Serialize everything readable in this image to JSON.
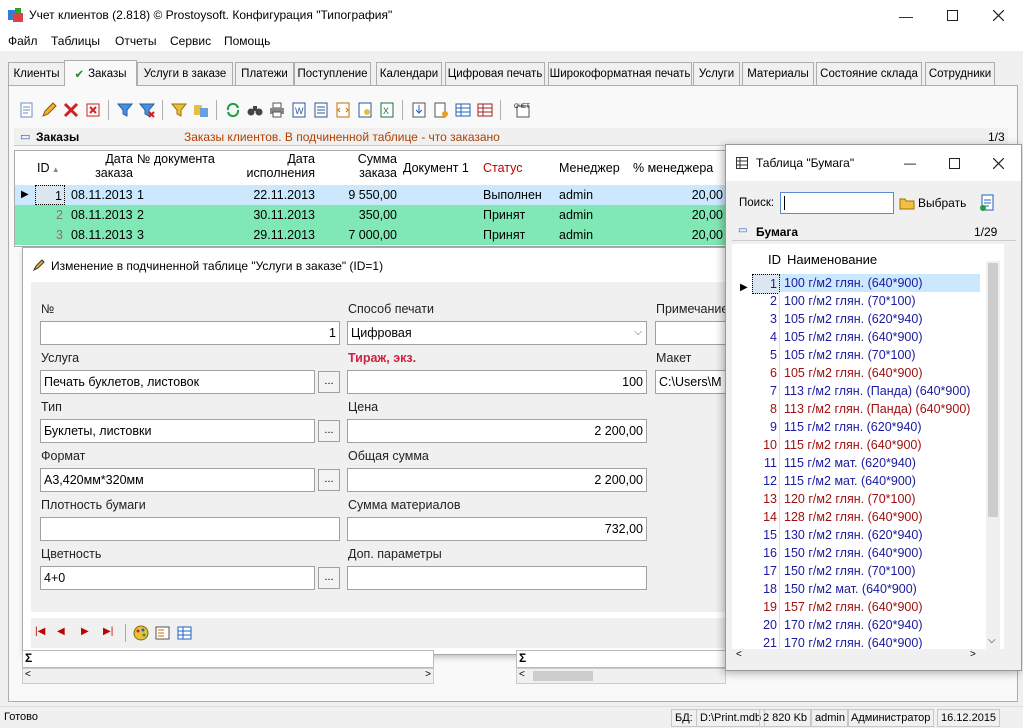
{
  "window": {
    "title": "Учет клиентов (2.818) © Prostoysoft. Конфигурация \"Типография\""
  },
  "menu": [
    "Файл",
    "Таблицы",
    "Отчеты",
    "Сервис",
    "Помощь"
  ],
  "tabs": [
    "Клиенты",
    "Заказы",
    "Услуги в заказе",
    "Платежи",
    "Поступление",
    "Календари",
    "Цифровая печать",
    "Широкоформатная печать",
    "Услуги",
    "Материалы",
    "Состояние склада",
    "Сотрудники"
  ],
  "orders": {
    "header_title": "Заказы",
    "header_desc": "Заказы клиентов. В подчиненной таблице - что заказано",
    "counter": "1/3",
    "columns": [
      "ID",
      "Дата заказа",
      "№ документа",
      "Дата исполнения",
      "Сумма заказа",
      "Документ 1",
      "Статус",
      "Менеджер",
      "% менеджера"
    ],
    "rows": [
      {
        "id": "1",
        "date": "08.11.2013",
        "num": "1",
        "exec": "22.11.2013",
        "sum": "9 550,00",
        "doc": "",
        "status": "Выполнен",
        "manager": "admin",
        "pct": "20,00"
      },
      {
        "id": "2",
        "date": "08.11.2013",
        "num": "2",
        "exec": "30.11.2013",
        "sum": "350,00",
        "doc": "",
        "status": "Принят",
        "manager": "admin",
        "pct": "20,00"
      },
      {
        "id": "3",
        "date": "08.11.2013",
        "num": "3",
        "exec": "29.11.2013",
        "sum": "7 000,00",
        "doc": "",
        "status": "Принят",
        "manager": "admin",
        "pct": "20,00"
      }
    ]
  },
  "editor": {
    "title": "Изменение в подчиненной таблице \"Услуги в заказе\" (ID=1)",
    "num_label": "№",
    "num_value": "1",
    "print_label": "Способ печати",
    "print_value": "Цифровая",
    "note_label": "Примечание",
    "service_label": "Услуга",
    "service_value": "Печать буклетов, листовок",
    "tirage_label": "Тираж, экз.",
    "tirage_value": "100",
    "maket_label": "Макет",
    "maket_value": "C:\\Users\\M",
    "type_label": "Тип",
    "type_value": "Буклеты, листовки",
    "price_label": "Цена",
    "price_value": "2 200,00",
    "format_label": "Формат",
    "format_value": "А3,420мм*320мм",
    "total_label": "Общая сумма",
    "total_value": "2 200,00",
    "density_label": "Плотность бумаги",
    "density_value": "",
    "materials_label": "Сумма материалов",
    "materials_value": "732,00",
    "color_label": "Цветность",
    "color_value": "4+0",
    "extra_label": "Доп. параметры",
    "extra_value": ""
  },
  "paper": {
    "title": "Таблица \"Бумага\"",
    "search_label": "Поиск:",
    "select_label": "Выбрать",
    "header_title": "Бумага",
    "counter": "1/29",
    "col_id": "ID",
    "col_name": "Наименование",
    "rows": [
      {
        "id": "1",
        "name": "100 г/м2 глян. (640*900)",
        "red": false
      },
      {
        "id": "2",
        "name": "100 г/м2 глян. (70*100)",
        "red": false
      },
      {
        "id": "3",
        "name": "105 г/м2 глян. (620*940)",
        "red": false
      },
      {
        "id": "4",
        "name": "105 г/м2 глян. (640*900)",
        "red": false
      },
      {
        "id": "5",
        "name": "105 г/м2 глян. (70*100)",
        "red": false
      },
      {
        "id": "6",
        "name": "105 г/м2 глян. (640*900)",
        "red": true
      },
      {
        "id": "7",
        "name": "113 г/м2 глян. (Панда) (640*900)",
        "red": false
      },
      {
        "id": "8",
        "name": "113 г/м2 глян. (Панда) (640*900)",
        "red": true
      },
      {
        "id": "9",
        "name": "115 г/м2 глян. (620*940)",
        "red": false
      },
      {
        "id": "10",
        "name": "115 г/м2 глян. (640*900)",
        "red": true
      },
      {
        "id": "11",
        "name": "115 г/м2 мат. (620*940)",
        "red": false
      },
      {
        "id": "12",
        "name": "115 г/м2 мат. (640*900)",
        "red": false
      },
      {
        "id": "13",
        "name": "120 г/м2 глян. (70*100)",
        "red": true
      },
      {
        "id": "14",
        "name": "128 г/м2 глян. (640*900)",
        "red": true
      },
      {
        "id": "15",
        "name": "130 г/м2 глян. (620*940)",
        "red": false
      },
      {
        "id": "16",
        "name": "150 г/м2 глян. (640*900)",
        "red": false
      },
      {
        "id": "17",
        "name": "150 г/м2 глян. (70*100)",
        "red": false
      },
      {
        "id": "18",
        "name": "150 г/м2 мат. (640*900)",
        "red": false
      },
      {
        "id": "19",
        "name": "157 г/м2 глян. (640*900)",
        "red": true
      },
      {
        "id": "20",
        "name": "170 г/м2 глян. (620*940)",
        "red": false
      },
      {
        "id": "21",
        "name": "170 г/м2 глян. (640*900)",
        "red": false
      }
    ]
  },
  "status": {
    "ready": "Готово",
    "db_label": "БД:",
    "db_path": "D:\\Print.mdb",
    "size": "2 820 Kb",
    "user": "admin",
    "role": "Администратор",
    "date": "16.12.2015"
  },
  "sigma": "Σ",
  "colors": {
    "selected_row": "#cce8ff",
    "green_row": "#80e8b4",
    "status_red": "#c00000",
    "name_blue": "#1a1aa0",
    "name_red": "#a01010"
  }
}
